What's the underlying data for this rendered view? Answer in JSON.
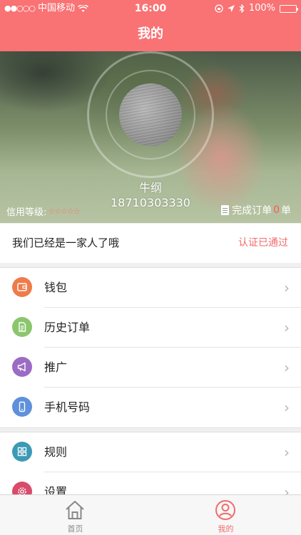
{
  "status_bar": {
    "carrier": "中国移动",
    "time": "16:00",
    "battery": "100%"
  },
  "header": {
    "title": "我的"
  },
  "profile": {
    "name": "牛纲",
    "phone": "18710303330",
    "credit_label": "信用等级:",
    "credit_stars": "☆☆☆☆☆",
    "orders_prefix": "完成订单",
    "orders_count": "0",
    "orders_suffix": "单"
  },
  "family": {
    "text": "我们已经是一家人了哦",
    "status": "认证已通过",
    "status_color": "#f26b6b"
  },
  "menu_group_1": [
    {
      "label": "钱包",
      "icon": "wallet-icon",
      "color": "#ef7b4a"
    },
    {
      "label": "历史订单",
      "icon": "history-order-icon",
      "color": "#8bc66d"
    },
    {
      "label": "推广",
      "icon": "megaphone-icon",
      "color": "#9a6cc4"
    },
    {
      "label": "手机号码",
      "icon": "mobile-phone-icon",
      "color": "#5f90dc"
    }
  ],
  "menu_group_2": [
    {
      "label": "规则",
      "icon": "grid-icon",
      "color": "#3d9ab6"
    },
    {
      "label": "设置",
      "icon": "gear-icon",
      "color": "#d94b6b"
    }
  ],
  "tabbar": {
    "home": "首页",
    "mine": "我的",
    "active_color": "#f26b6b",
    "inactive_color": "#888888"
  },
  "colors": {
    "header_bg": "#f97274"
  }
}
